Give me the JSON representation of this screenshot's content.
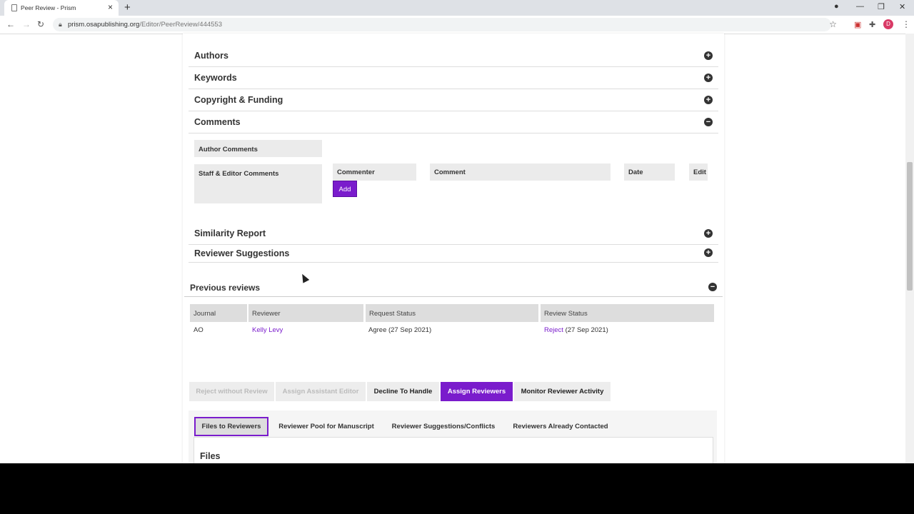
{
  "browser": {
    "tab_title": "Peer Review - Prism",
    "url_domain": "prism.osapublishing.org",
    "url_path": "/Editor/PeerReview/444553",
    "avatar_letter": "D"
  },
  "sections": [
    {
      "label": "Authors",
      "state": "collapsed"
    },
    {
      "label": "Keywords",
      "state": "collapsed"
    },
    {
      "label": "Copyright & Funding",
      "state": "collapsed"
    },
    {
      "label": "Comments",
      "state": "expanded"
    }
  ],
  "comments": {
    "author_comments_label": "Author Comments",
    "staff_editor_label": "Staff & Editor Comments",
    "columns": [
      "Commenter",
      "Comment",
      "Date",
      "Edit"
    ],
    "add_label": "Add"
  },
  "lower_sections": [
    {
      "label": "Similarity Report",
      "state": "collapsed"
    },
    {
      "label": "Reviewer Suggestions",
      "state": "collapsed"
    }
  ],
  "previous_reviews": {
    "title": "Previous reviews",
    "columns": [
      "Journal",
      "Reviewer",
      "Request Status",
      "Review Status"
    ],
    "rows": [
      {
        "journal": "AO",
        "reviewer": "Kelly Levy",
        "request_status": "Agree (27 Sep 2021)",
        "review_status_link": "Reject",
        "review_status_date": "(27 Sep 2021)"
      }
    ]
  },
  "actions": [
    {
      "label": "Reject without Review",
      "state": "disabled"
    },
    {
      "label": "Assign Assistant Editor",
      "state": "disabled"
    },
    {
      "label": "Decline To Handle",
      "state": "normal"
    },
    {
      "label": "Assign Reviewers",
      "state": "active"
    },
    {
      "label": "Monitor Reviewer Activity",
      "state": "normal"
    }
  ],
  "subtabs": [
    {
      "label": "Files to Reviewers",
      "selected": true
    },
    {
      "label": "Reviewer Pool for Manuscript",
      "selected": false
    },
    {
      "label": "Reviewer Suggestions/Conflicts",
      "selected": false
    },
    {
      "label": "Reviewers Already Contacted",
      "selected": false
    }
  ],
  "files_title": "Files",
  "colors": {
    "accent": "#7a1ccc"
  }
}
